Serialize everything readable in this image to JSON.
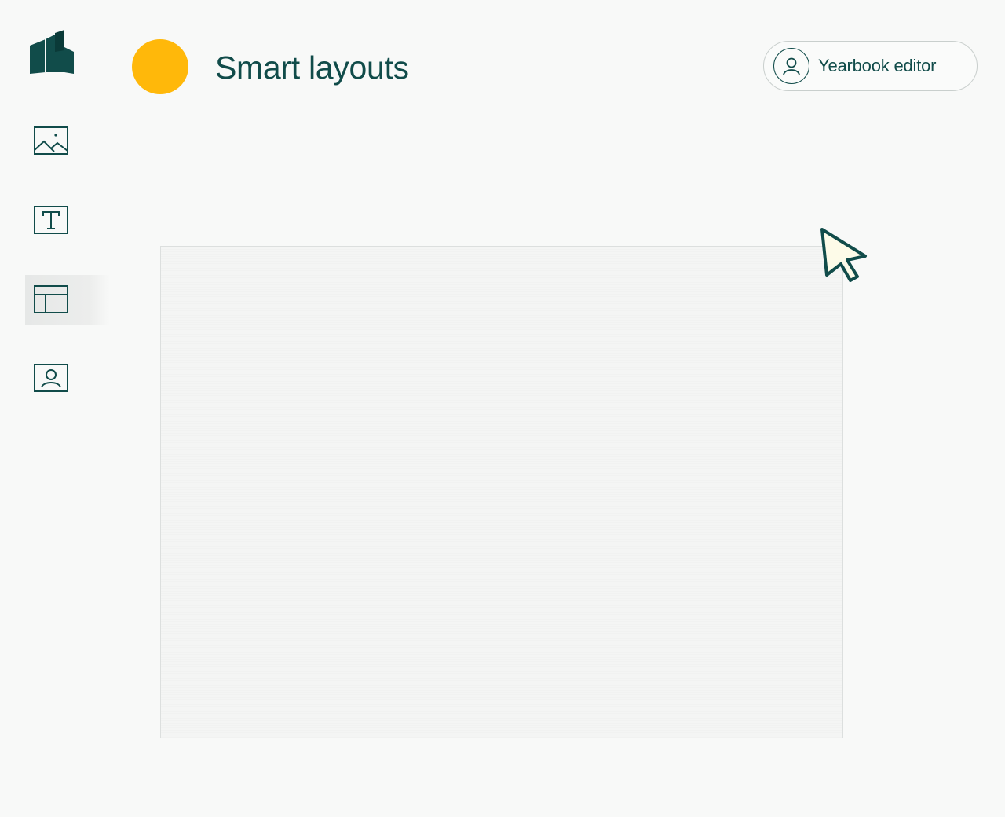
{
  "header": {
    "title": "Smart layouts",
    "accent_color": "#FFB80A"
  },
  "role": {
    "label": "Yearbook editor",
    "icon": "user-icon"
  },
  "sidebar": {
    "logo": "book-logo",
    "items": [
      {
        "name": "photos",
        "icon": "image-icon",
        "active": false
      },
      {
        "name": "text",
        "icon": "text-icon",
        "active": false
      },
      {
        "name": "layouts",
        "icon": "layout-icon",
        "active": true
      },
      {
        "name": "portraits",
        "icon": "portrait-icon",
        "active": false
      }
    ]
  },
  "colors": {
    "brand": "#114C4A",
    "background": "#F8F9F8",
    "canvas": "#F4F5F4"
  }
}
